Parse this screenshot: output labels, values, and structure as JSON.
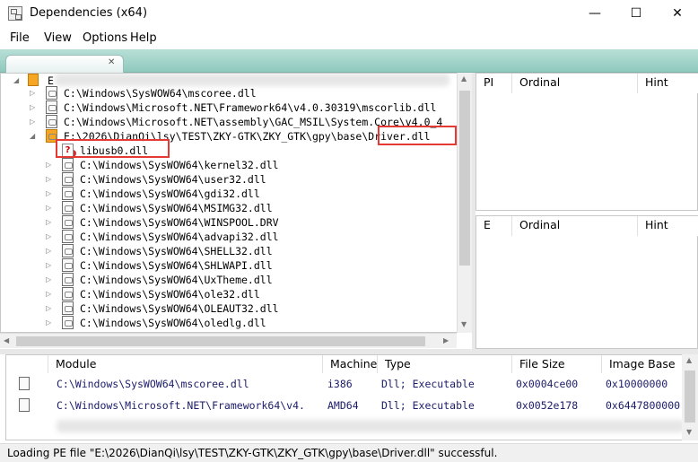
{
  "window": {
    "title": "Dependencies (x64)",
    "minimize": "—",
    "maximize": "☐",
    "close": "✕"
  },
  "menu": {
    "file": "File",
    "view": "View",
    "options": "Options",
    "help": "Help"
  },
  "tree": {
    "root_label": "E",
    "items": [
      {
        "label": "C:\\Windows\\SysWOW64\\mscoree.dll",
        "level": 1,
        "missing": false
      },
      {
        "label": "C:\\Windows\\Microsoft.NET\\Framework64\\v4.0.30319\\mscorlib.dll",
        "level": 1,
        "missing": false
      },
      {
        "label": "C:\\Windows\\Microsoft.NET\\assembly\\GAC_MSIL\\System.Core\\v4.0_4",
        "level": 1,
        "missing": false
      },
      {
        "label": "E:\\2026\\DianQi\\lsy\\TEST\\ZKY-GTK\\ZKY_GTK\\gpy\\base\\Driver.dll",
        "level": 1,
        "missing": false,
        "expanded": true
      },
      {
        "label": "libusb0.dll",
        "level": 2,
        "missing": true
      },
      {
        "label": "C:\\Windows\\SysWOW64\\kernel32.dll",
        "level": 2,
        "missing": false
      },
      {
        "label": "C:\\Windows\\SysWOW64\\user32.dll",
        "level": 2,
        "missing": false
      },
      {
        "label": "C:\\Windows\\SysWOW64\\gdi32.dll",
        "level": 2,
        "missing": false
      },
      {
        "label": "C:\\Windows\\SysWOW64\\MSIMG32.dll",
        "level": 2,
        "missing": false
      },
      {
        "label": "C:\\Windows\\SysWOW64\\WINSPOOL.DRV",
        "level": 2,
        "missing": false
      },
      {
        "label": "C:\\Windows\\SysWOW64\\advapi32.dll",
        "level": 2,
        "missing": false
      },
      {
        "label": "C:\\Windows\\SysWOW64\\SHELL32.dll",
        "level": 2,
        "missing": false
      },
      {
        "label": "C:\\Windows\\SysWOW64\\SHLWAPI.dll",
        "level": 2,
        "missing": false
      },
      {
        "label": "C:\\Windows\\SysWOW64\\UxTheme.dll",
        "level": 2,
        "missing": false
      },
      {
        "label": "C:\\Windows\\SysWOW64\\ole32.dll",
        "level": 2,
        "missing": false
      },
      {
        "label": "C:\\Windows\\SysWOW64\\OLEAUT32.dll",
        "level": 2,
        "missing": false
      },
      {
        "label": "C:\\Windows\\SysWOW64\\oledlg.dll",
        "level": 2,
        "missing": false
      }
    ]
  },
  "imports": {
    "cols": [
      "PI",
      "Ordinal",
      "Hint"
    ]
  },
  "exports": {
    "cols": [
      "E",
      "Ordinal",
      "Hint"
    ]
  },
  "modules": {
    "cols": [
      "Module",
      "Machine",
      "Type",
      "File Size",
      "Image Base"
    ],
    "rows": [
      [
        "C:\\Windows\\SysWOW64\\mscoree.dll",
        "i386",
        "Dll; Executable",
        "0x0004ce00",
        "0x10000000"
      ],
      [
        "C:\\Windows\\Microsoft.NET\\Framework64\\v4.",
        "AMD64",
        "Dll; Executable",
        "0x0052e178",
        "0x6447800000"
      ]
    ]
  },
  "status": "Loading PE file \"E:\\2026\\DianQi\\lsy\\TEST\\ZKY-GTK\\ZKY_GTK\\gpy\\base\\Driver.dll\" successful.",
  "colors": {
    "highlight_box": "#e53935",
    "toolbar": "#9fd0c6",
    "module_text": "#1b1b6a"
  }
}
